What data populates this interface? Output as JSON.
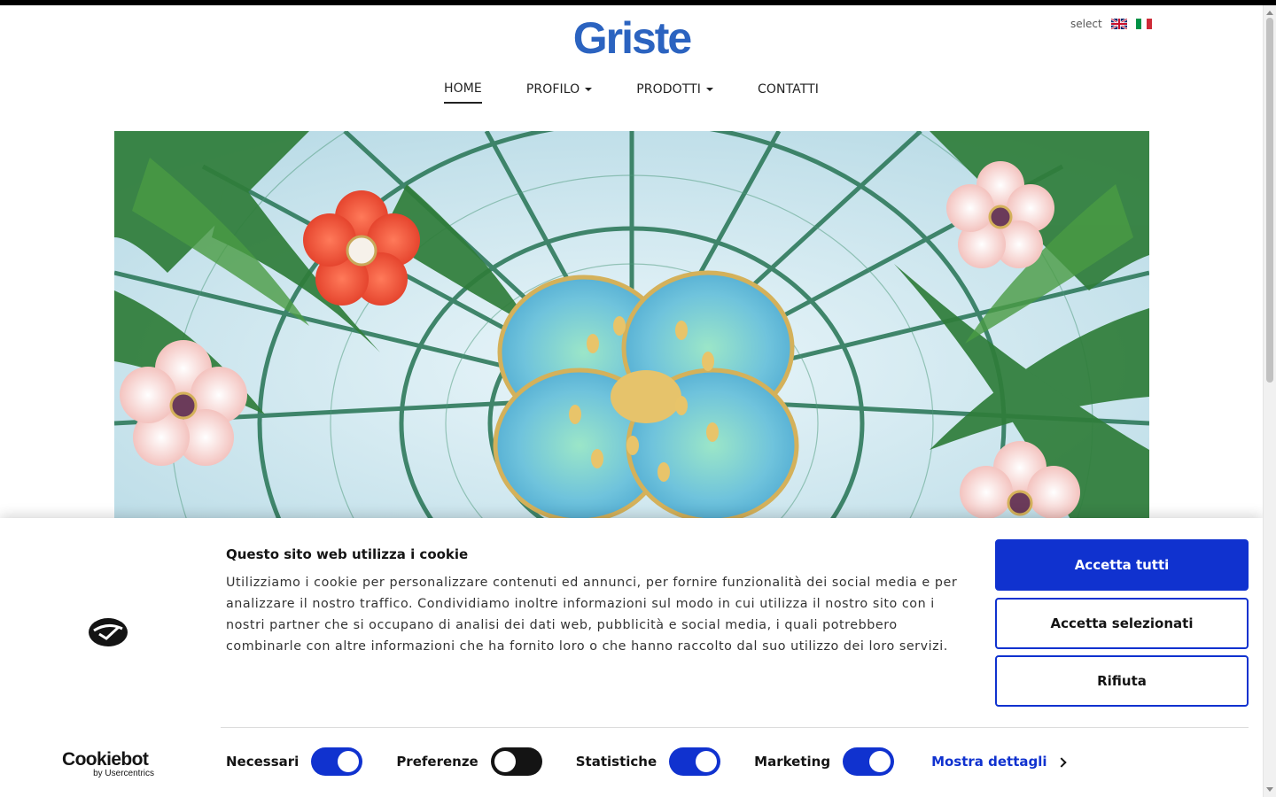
{
  "brand": {
    "name": "Griste",
    "logo_color": "#2b63c0"
  },
  "language": {
    "label": "select",
    "options": [
      {
        "code": "en",
        "icon": "uk-flag-icon"
      },
      {
        "code": "it",
        "icon": "italy-flag-icon"
      }
    ]
  },
  "nav": {
    "items": [
      {
        "label": "HOME",
        "active": true,
        "dropdown": false
      },
      {
        "label": "PROFILO",
        "active": false,
        "dropdown": true
      },
      {
        "label": "PRODOTTI",
        "active": false,
        "dropdown": true
      },
      {
        "label": "CONTATTI",
        "active": false,
        "dropdown": false
      }
    ]
  },
  "cookie": {
    "title": "Questo sito web utilizza i cookie",
    "body": "Utilizziamo i cookie per personalizzare contenuti ed annunci, per fornire funzionalità dei social media e per analizzare il nostro traffico. Condividiamo inoltre informazioni sul modo in cui utilizza il nostro sito con i nostri partner che si occupano di analisi dei dati web, pubblicità e social media, i quali potrebbero combinarle con altre informazioni che ha fornito loro o che hanno raccolto dal suo utilizzo dei loro servizi.",
    "buttons": {
      "accept_all": "Accetta tutti",
      "accept_selected": "Accetta selezionati",
      "reject": "Rifiuta"
    },
    "toggles": [
      {
        "label": "Necessari",
        "on": true
      },
      {
        "label": "Preferenze",
        "on": false
      },
      {
        "label": "Statistiche",
        "on": true
      },
      {
        "label": "Marketing",
        "on": true
      }
    ],
    "details_link": "Mostra dettagli",
    "provider": {
      "name": "Cookiebot",
      "sub": "by Usercentrics"
    },
    "accent_color": "#1032cf"
  }
}
